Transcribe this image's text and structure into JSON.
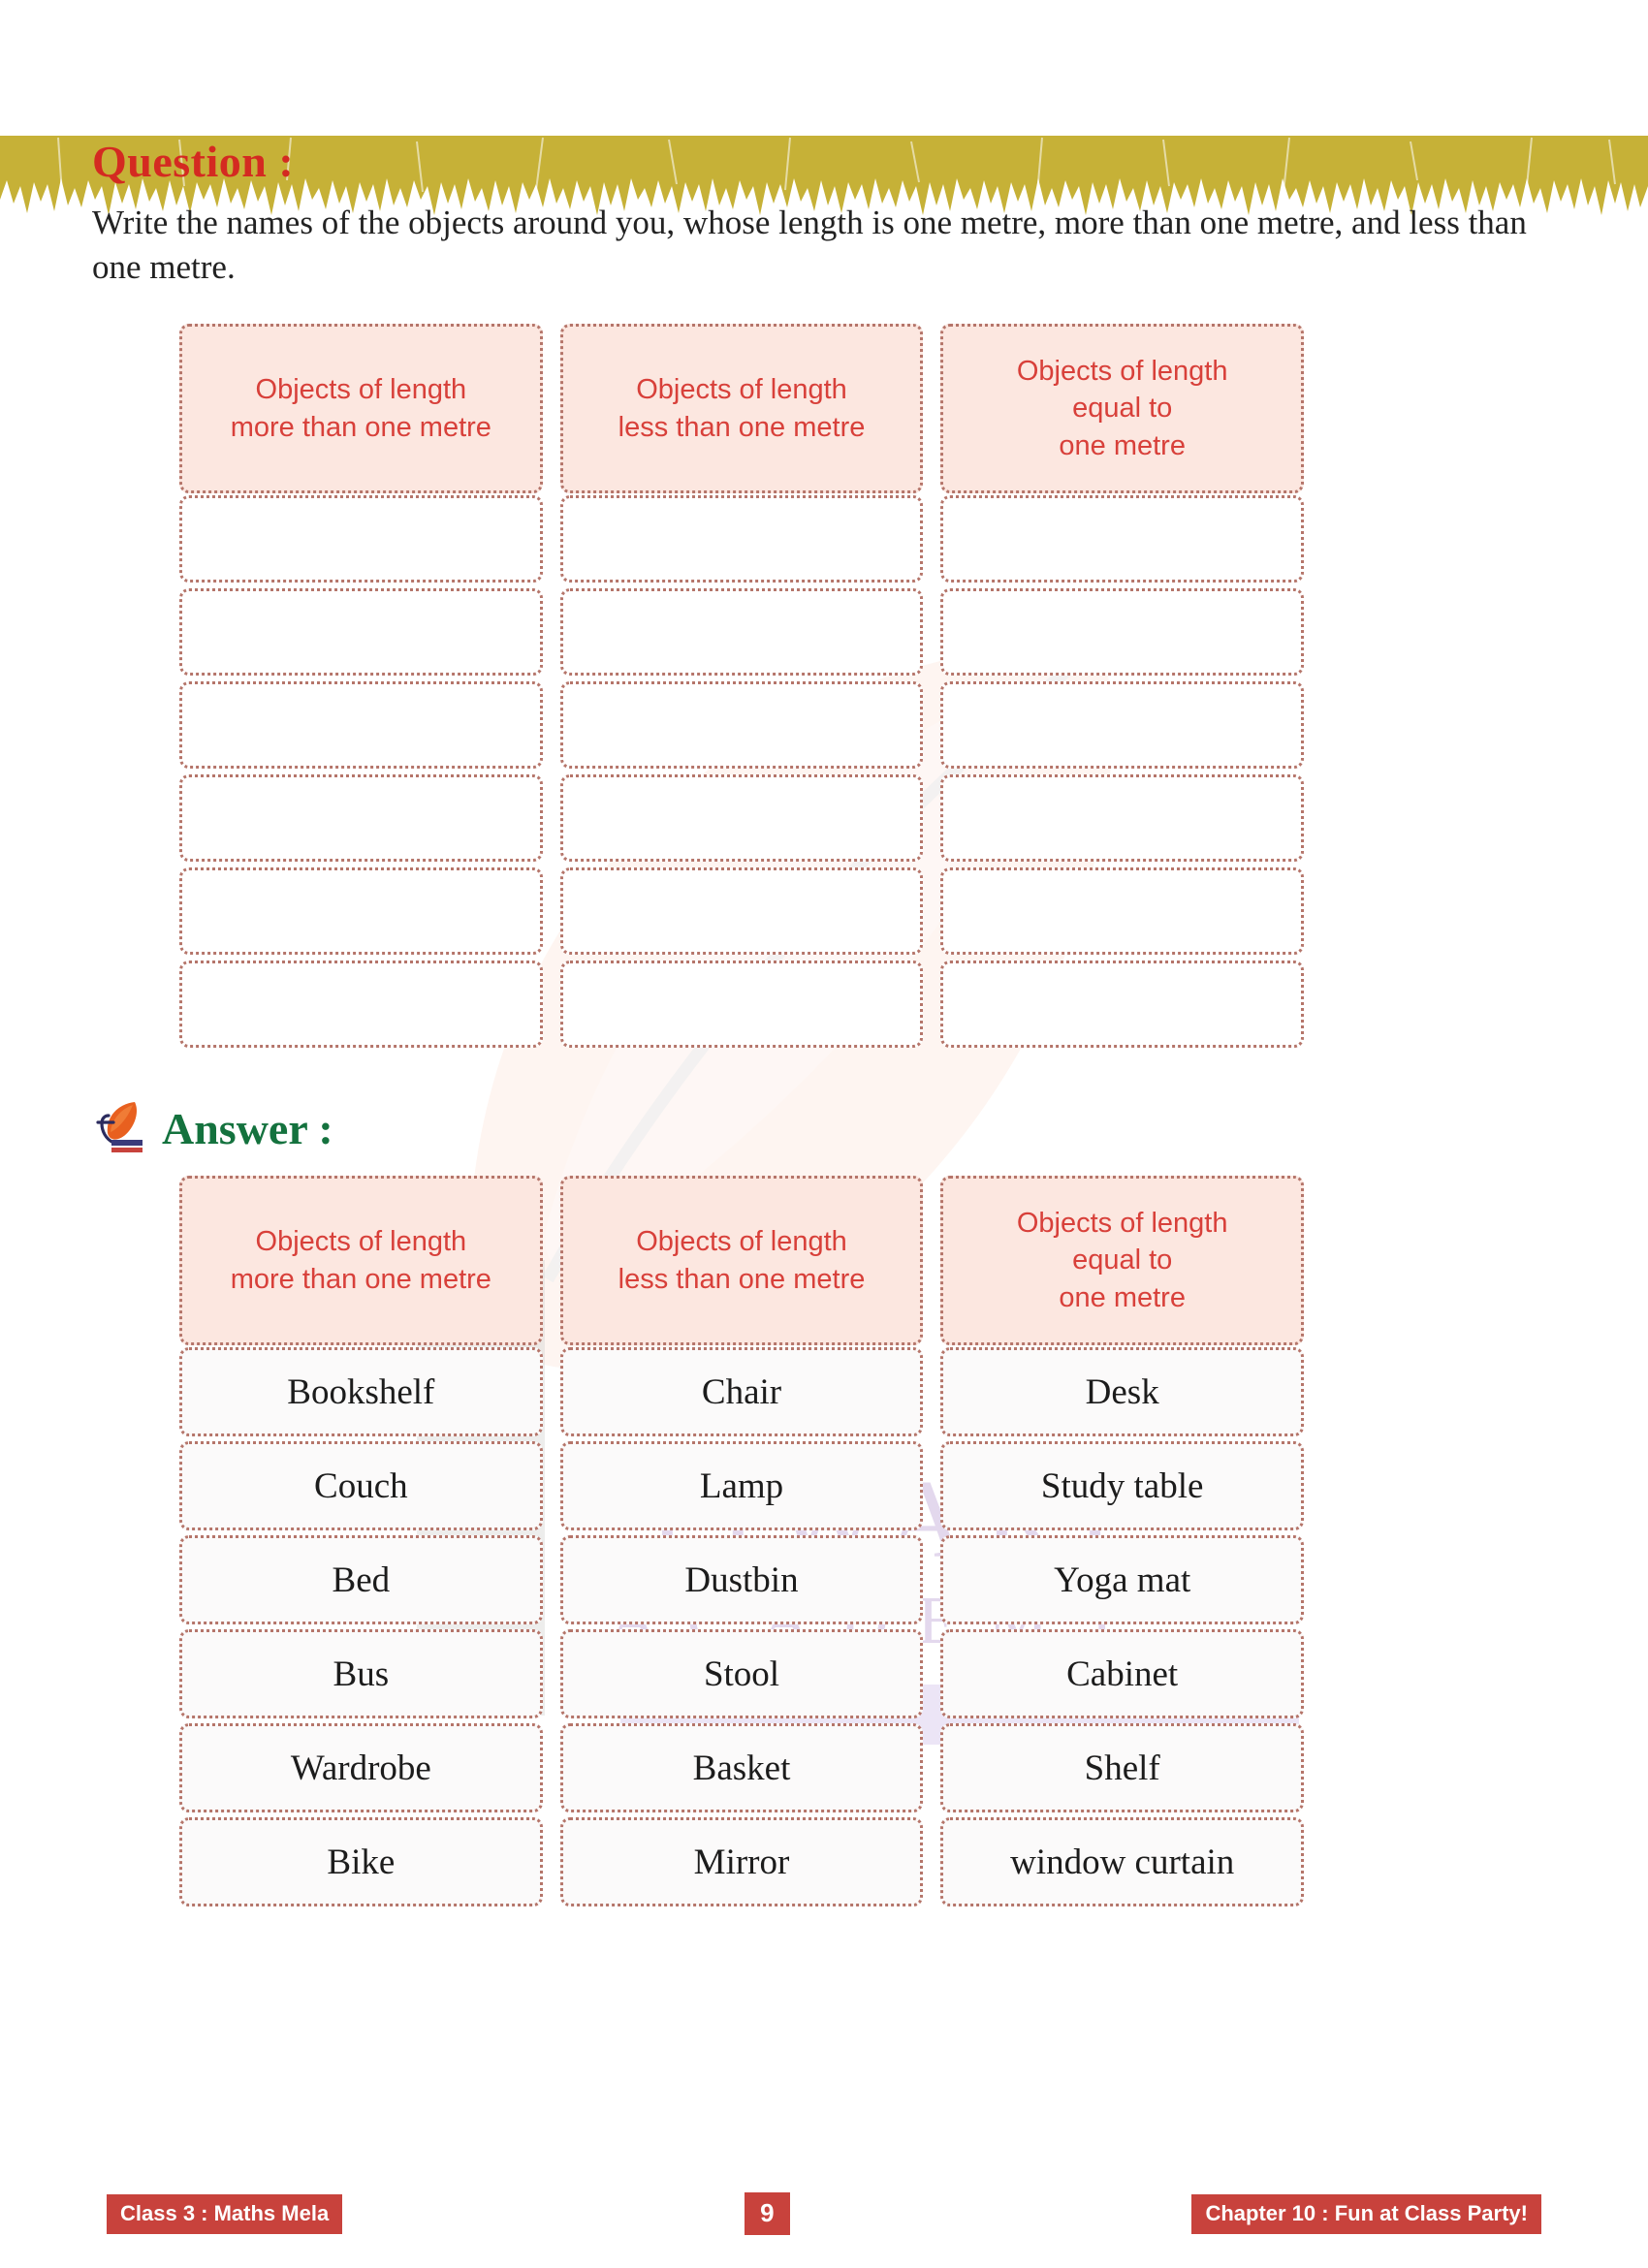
{
  "question": {
    "heading": "Question :",
    "text": "Write the names of the objects around you, whose length is one metre, more than one metre, and less than one metre."
  },
  "answer": {
    "heading": "Answer :",
    "logo_icon": "tiwari-academy-leaf-logo"
  },
  "columns": [
    {
      "line1": "Objects of length",
      "line2": "more than one metre",
      "line3": ""
    },
    {
      "line1": "Objects of length",
      "line2": "less than one metre",
      "line3": ""
    },
    {
      "line1": "Objects of length",
      "line2": "equal to",
      "line3": "one metre"
    }
  ],
  "question_table": {
    "blank_row_count": 6
  },
  "answer_table": {
    "rows": [
      [
        "Bookshelf",
        "Chair",
        "Desk"
      ],
      [
        "Couch",
        "Lamp",
        "Study table"
      ],
      [
        "Bed",
        "Dustbin",
        "Yoga mat"
      ],
      [
        "Bus",
        "Stool",
        "Cabinet"
      ],
      [
        "Wardrobe",
        "Basket",
        "Shelf"
      ],
      [
        "Bike",
        "Mirror",
        "window curtain"
      ]
    ]
  },
  "watermark": {
    "line1": "TIWARI",
    "line2": "ACADEMY"
  },
  "footer": {
    "left": "Class 3 : Maths Mela",
    "page": "9",
    "right": "Chapter 10 : Fun at Class Party!"
  },
  "colors": {
    "heading_red": "#d42a21",
    "answer_green": "#14723e",
    "header_box_fill": "#fce7e0",
    "header_box_text": "#d8403a",
    "cell_border": "#b5756a",
    "footer_red": "#c8423c",
    "top_band": "#c6b137",
    "watermark_purple": "#cdb9e0"
  }
}
